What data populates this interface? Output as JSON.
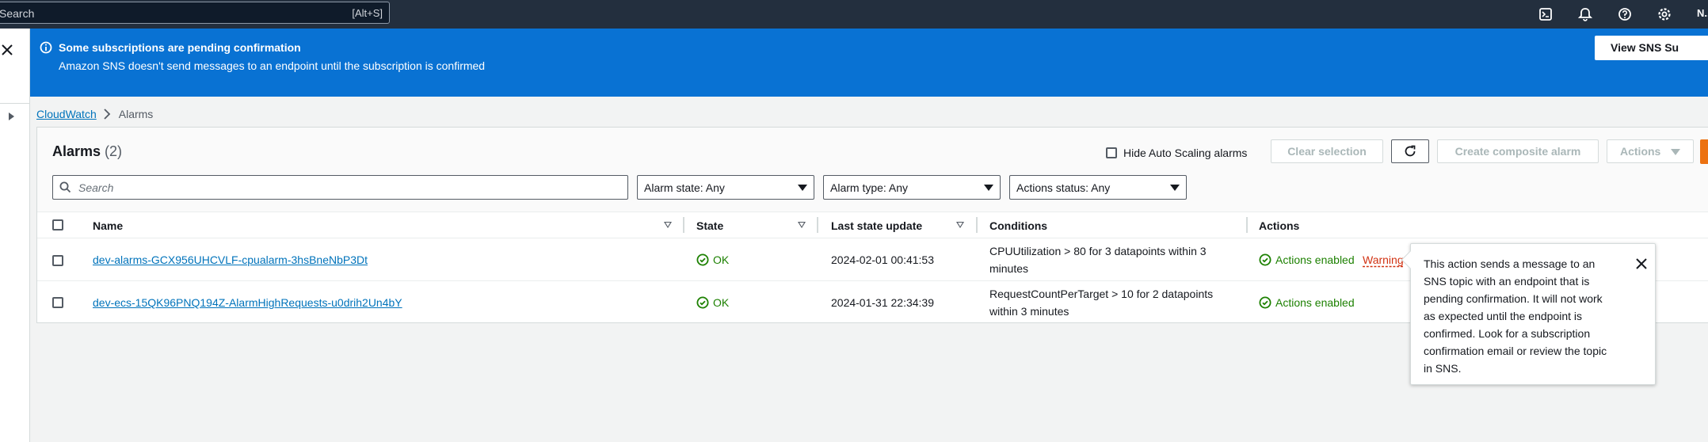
{
  "topnav": {
    "search_placeholder": "Search",
    "search_shortcut": "[Alt+S]",
    "icons": [
      "cloudshell-icon",
      "notifications-icon",
      "help-icon",
      "settings-icon"
    ],
    "user": "N..."
  },
  "banner": {
    "title": "Some subscriptions are pending confirmation",
    "description": "Amazon SNS doesn't send messages to an endpoint until the subscription is confirmed",
    "button": "View SNS Su",
    "color": "#0972d3"
  },
  "breadcrumb": {
    "root": "CloudWatch",
    "current": "Alarms"
  },
  "alarms": {
    "title": "Alarms",
    "count": "(2)",
    "hide_autoscaling": "Hide Auto Scaling alarms",
    "clear_selection": "Clear selection",
    "create_composite": "Create composite alarm",
    "actions": "Actions",
    "search_placeholder": "Search",
    "filters": {
      "state": "Alarm state: Any",
      "type": "Alarm type: Any",
      "actions": "Actions status: Any"
    },
    "columns": {
      "name": "Name",
      "state": "State",
      "updated": "Last state update",
      "conditions": "Conditions",
      "actions": "Actions"
    },
    "rows": [
      {
        "name": "dev-alarms-GCX956UHCVLF-cpualarm-3hsBneNbP3Dt",
        "state": "OK",
        "updated": "2024-02-01 00:41:53",
        "conditions_line1": "CPUUtilization > 80 for 3 datapoints within 3",
        "conditions_line2": "minutes",
        "actions": "Actions enabled",
        "warning": "Warning"
      },
      {
        "name": "dev-ecs-15QK96PNQ194Z-AlarmHighRequests-u0drih2Un4bY",
        "state": "OK",
        "updated": "2024-01-31 22:34:39",
        "conditions_line1": "RequestCountPerTarget > 10 for 2 datapoints",
        "conditions_line2": "within 3 minutes",
        "actions": "Actions enabled"
      }
    ]
  },
  "popover": {
    "text": "This action sends a message to an SNS topic with an endpoint that is pending confirmation. It will not work as expected until the endpoint is confirmed. Look for a subscription confirmation email or review the topic in SNS."
  },
  "colors": {
    "link": "#0073bb",
    "ok": "#1d8102",
    "warning": "#d13212",
    "primary": "#ec7211"
  }
}
